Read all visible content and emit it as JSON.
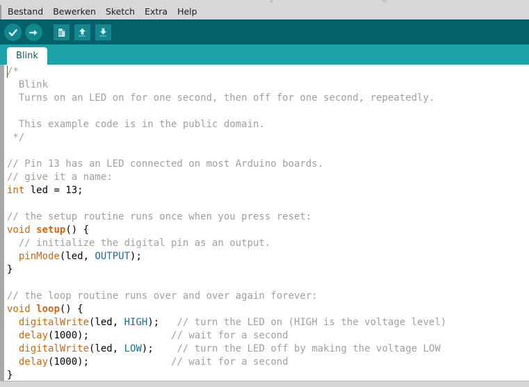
{
  "window": {
    "chrome_glyphs": [
      "⬜",
      "▭"
    ]
  },
  "menubar": {
    "items": [
      {
        "label": "Bestand",
        "name": "menu-item-bestand"
      },
      {
        "label": "Bewerken",
        "name": "menu-item-bewerken"
      },
      {
        "label": "Sketch",
        "name": "menu-item-sketch"
      },
      {
        "label": "Extra",
        "name": "menu-item-extra"
      },
      {
        "label": "Help",
        "name": "menu-item-help"
      }
    ]
  },
  "toolbar": {
    "background": "#046169",
    "button_fill": "#12878e",
    "buttons": [
      {
        "icon": "verify-checkmark-icon",
        "label": "Verify",
        "shape": "round"
      },
      {
        "icon": "upload-arrow-icon",
        "label": "Upload",
        "shape": "round"
      },
      {
        "icon": "new-document-icon",
        "label": "New",
        "shape": "square"
      },
      {
        "icon": "open-upload-icon",
        "label": "Open",
        "shape": "square"
      },
      {
        "icon": "save-download-icon",
        "label": "Save",
        "shape": "square"
      }
    ]
  },
  "tabbar": {
    "background": "#1ba3aa",
    "tabs": [
      {
        "label": "Blink",
        "active": true
      }
    ]
  },
  "editor": {
    "colors": {
      "comment": "#a0a0a0",
      "keyword": "#d8670a",
      "constant": "#1a6d96",
      "text": "#000000",
      "background": "#ffffff",
      "gutter": "#a8a8a8"
    },
    "lines": [
      {
        "n": 1,
        "tokens": [
          {
            "t": "cmt",
            "s": "/*"
          }
        ]
      },
      {
        "n": 2,
        "tokens": [
          {
            "t": "cmt",
            "s": "  Blink"
          }
        ]
      },
      {
        "n": 3,
        "tokens": [
          {
            "t": "cmt",
            "s": "  Turns on an LED on for one second, then off for one second, repeatedly."
          }
        ]
      },
      {
        "n": 4,
        "tokens": [
          {
            "t": "cmt",
            "s": ""
          }
        ]
      },
      {
        "n": 5,
        "tokens": [
          {
            "t": "cmt",
            "s": "  This example code is in the public domain."
          }
        ]
      },
      {
        "n": 6,
        "tokens": [
          {
            "t": "cmt",
            "s": " */"
          }
        ]
      },
      {
        "n": 7,
        "tokens": [
          {
            "t": "pn",
            "s": ""
          }
        ]
      },
      {
        "n": 8,
        "tokens": [
          {
            "t": "cmt",
            "s": "// Pin 13 has an LED connected on most Arduino boards."
          }
        ]
      },
      {
        "n": 9,
        "tokens": [
          {
            "t": "cmt",
            "s": "// give it a name:"
          }
        ]
      },
      {
        "n": 10,
        "tokens": [
          {
            "t": "kw",
            "s": "int"
          },
          {
            "t": "pn",
            "s": " led = 13;"
          }
        ]
      },
      {
        "n": 11,
        "tokens": [
          {
            "t": "pn",
            "s": ""
          }
        ]
      },
      {
        "n": 12,
        "tokens": [
          {
            "t": "cmt",
            "s": "// the setup routine runs once when you press reset:"
          }
        ]
      },
      {
        "n": 13,
        "tokens": [
          {
            "t": "kw",
            "s": "void"
          },
          {
            "t": "pn",
            "s": " "
          },
          {
            "t": "fn",
            "s": "setup"
          },
          {
            "t": "pn",
            "s": "() {"
          }
        ]
      },
      {
        "n": 14,
        "tokens": [
          {
            "t": "cmt",
            "s": "  // initialize the digital pin as an output."
          }
        ]
      },
      {
        "n": 15,
        "tokens": [
          {
            "t": "pn",
            "s": "  "
          },
          {
            "t": "bi",
            "s": "pinMode"
          },
          {
            "t": "pn",
            "s": "(led, "
          },
          {
            "t": "cst",
            "s": "OUTPUT"
          },
          {
            "t": "pn",
            "s": ");"
          }
        ]
      },
      {
        "n": 16,
        "tokens": [
          {
            "t": "pn",
            "s": "}"
          }
        ]
      },
      {
        "n": 17,
        "tokens": [
          {
            "t": "pn",
            "s": ""
          }
        ]
      },
      {
        "n": 18,
        "tokens": [
          {
            "t": "cmt",
            "s": "// the loop routine runs over and over again forever:"
          }
        ]
      },
      {
        "n": 19,
        "tokens": [
          {
            "t": "kw",
            "s": "void"
          },
          {
            "t": "pn",
            "s": " "
          },
          {
            "t": "fn",
            "s": "loop"
          },
          {
            "t": "pn",
            "s": "() {"
          }
        ]
      },
      {
        "n": 20,
        "tokens": [
          {
            "t": "pn",
            "s": "  "
          },
          {
            "t": "bi",
            "s": "digitalWrite"
          },
          {
            "t": "pn",
            "s": "(led, "
          },
          {
            "t": "cst",
            "s": "HIGH"
          },
          {
            "t": "pn",
            "s": ");   "
          },
          {
            "t": "cmt",
            "s": "// turn the LED on (HIGH is the voltage level)"
          }
        ]
      },
      {
        "n": 21,
        "tokens": [
          {
            "t": "pn",
            "s": "  "
          },
          {
            "t": "bi",
            "s": "delay"
          },
          {
            "t": "pn",
            "s": "(1000);              "
          },
          {
            "t": "cmt",
            "s": "// wait for a second"
          }
        ]
      },
      {
        "n": 22,
        "tokens": [
          {
            "t": "pn",
            "s": "  "
          },
          {
            "t": "bi",
            "s": "digitalWrite"
          },
          {
            "t": "pn",
            "s": "(led, "
          },
          {
            "t": "cst",
            "s": "LOW"
          },
          {
            "t": "pn",
            "s": ");    "
          },
          {
            "t": "cmt",
            "s": "// turn the LED off by making the voltage LOW"
          }
        ]
      },
      {
        "n": 23,
        "tokens": [
          {
            "t": "pn",
            "s": "  "
          },
          {
            "t": "bi",
            "s": "delay"
          },
          {
            "t": "pn",
            "s": "(1000);              "
          },
          {
            "t": "cmt",
            "s": "// wait for a second"
          }
        ]
      },
      {
        "n": 24,
        "tokens": [
          {
            "t": "pn",
            "s": "}"
          }
        ]
      }
    ]
  }
}
